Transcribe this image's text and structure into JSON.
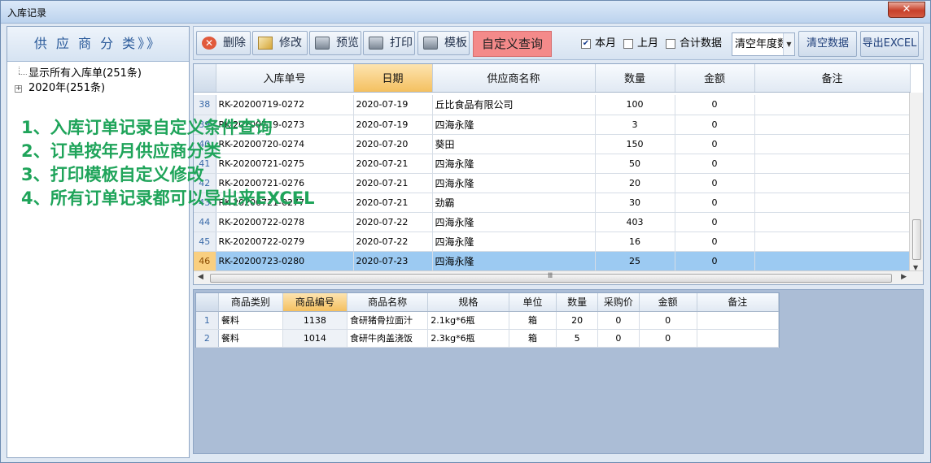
{
  "window": {
    "title": "入库记录",
    "close_label": "✕"
  },
  "left": {
    "header": "供 应 商 分 类》》",
    "tree": [
      {
        "label": "显示所有入库单(251条)"
      },
      {
        "label": "2020年(251条)",
        "expander": "+"
      }
    ]
  },
  "promo": [
    "1、入库订单记录自定义条件查询",
    "2、订单按年月供应商分类",
    "3、打印模板自定义修改",
    "4、所有订单记录都可以导出来EXCEL"
  ],
  "toolbar": {
    "delete": "删除",
    "edit": "修改",
    "preview": "预览",
    "print": "打印",
    "template": "模板",
    "custom_query": "自定义查询",
    "this_month": {
      "label": "本月",
      "checked": true
    },
    "last_month": {
      "label": "上月",
      "checked": false
    },
    "total": {
      "label": "合计数据",
      "checked": false
    },
    "year_combo": "清空年度数",
    "clear_data": "清空数据",
    "export_excel": "导出EXCEL"
  },
  "main_grid": {
    "columns": [
      "入库单号",
      "日期",
      "供应商名称",
      "数量",
      "金额",
      "备注"
    ],
    "rows": [
      {
        "n": "38",
        "no": "RK-20200719-0272",
        "date": "2020-07-19",
        "supplier": "丘比食品有限公司",
        "qty": "100",
        "amount": "0",
        "note": ""
      },
      {
        "n": "39",
        "no": "RK-20200719-0273",
        "date": "2020-07-19",
        "supplier": "四海永隆",
        "qty": "3",
        "amount": "0",
        "note": ""
      },
      {
        "n": "40",
        "no": "RK-20200720-0274",
        "date": "2020-07-20",
        "supplier": "葵田",
        "qty": "150",
        "amount": "0",
        "note": ""
      },
      {
        "n": "41",
        "no": "RK-20200721-0275",
        "date": "2020-07-21",
        "supplier": "四海永隆",
        "qty": "50",
        "amount": "0",
        "note": ""
      },
      {
        "n": "42",
        "no": "RK-20200721-0276",
        "date": "2020-07-21",
        "supplier": "四海永隆",
        "qty": "20",
        "amount": "0",
        "note": ""
      },
      {
        "n": "43",
        "no": "RK-20200721-0277",
        "date": "2020-07-21",
        "supplier": "劲霸",
        "qty": "30",
        "amount": "0",
        "note": ""
      },
      {
        "n": "44",
        "no": "RK-20200722-0278",
        "date": "2020-07-22",
        "supplier": "四海永隆",
        "qty": "403",
        "amount": "0",
        "note": ""
      },
      {
        "n": "45",
        "no": "RK-20200722-0279",
        "date": "2020-07-22",
        "supplier": "四海永隆",
        "qty": "16",
        "amount": "0",
        "note": ""
      },
      {
        "n": "46",
        "no": "RK-20200723-0280",
        "date": "2020-07-23",
        "supplier": "四海永隆",
        "qty": "25",
        "amount": "0",
        "note": "",
        "selected": true
      }
    ],
    "scroll_mid": "Ⅲ"
  },
  "detail_grid": {
    "columns": [
      "商品类别",
      "商品编号",
      "商品名称",
      "规格",
      "单位",
      "数量",
      "采购价",
      "金额",
      "备注"
    ],
    "rows": [
      {
        "n": "1",
        "cat": "餐料",
        "code": "1138",
        "name": "食研猪骨拉面汁",
        "spec": "2.1kg*6瓶",
        "unit": "箱",
        "qty": "20",
        "price": "0",
        "amount": "0",
        "note": ""
      },
      {
        "n": "2",
        "cat": "餐料",
        "code": "1014",
        "name": "食研牛肉盖浇饭",
        "spec": "2.3kg*6瓶",
        "unit": "箱",
        "qty": "5",
        "price": "0",
        "amount": "0",
        "note": ""
      }
    ]
  }
}
